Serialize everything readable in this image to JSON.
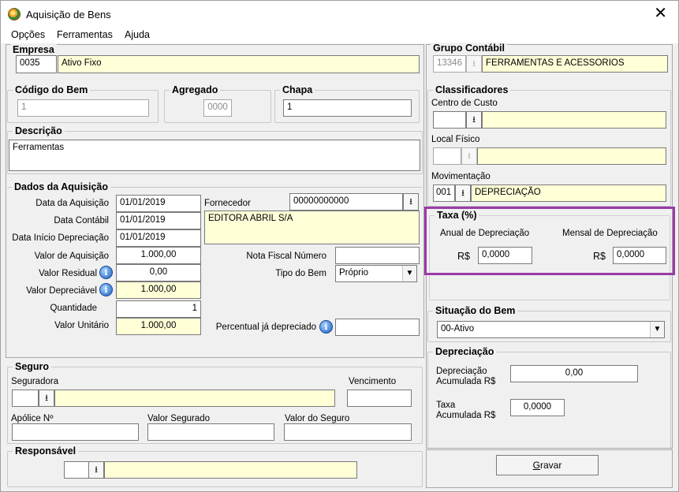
{
  "window": {
    "title": "Aquisição de Bens",
    "close_glyph": "✕"
  },
  "menu": [
    "Opções",
    "Ferramentas",
    "Ajuda"
  ],
  "empresa": {
    "legend": "Empresa",
    "code": "0035",
    "name": "Ativo Fixo"
  },
  "grupo": {
    "legend": "Grupo Contábil",
    "code": "13346",
    "name": "FERRAMENTAS E ACESSORIOS"
  },
  "codigo": {
    "legend": "Código do Bem",
    "value": "1"
  },
  "agregado": {
    "legend": "Agregado",
    "value": "0000"
  },
  "chapa": {
    "legend": "Chapa",
    "value": "1"
  },
  "descricao": {
    "legend": "Descrição",
    "value": "Ferramentas"
  },
  "classificadores": {
    "legend": "Classificadores",
    "centro_custo_label": "Centro de Custo",
    "local_fisico_label": "Local Físico",
    "movimentacao_label": "Movimentação",
    "movimentacao_code": "001",
    "movimentacao_name": "DEPRECIAÇÃO"
  },
  "dados": {
    "legend": "Dados da Aquisição",
    "data_aquisicao_label": "Data da Aquisição",
    "data_aquisicao": "01/01/2019",
    "data_contabil_label": "Data Contábil",
    "data_contabil": "01/01/2019",
    "data_inicio_label": "Data Início Depreciação",
    "data_inicio": "01/01/2019",
    "valor_aquisicao_label": "Valor de Aquisição",
    "valor_aquisicao": "1.000,00",
    "valor_residual_label": "Valor Residual",
    "valor_residual": "0,00",
    "valor_depreciavel_label": "Valor Depreciável",
    "valor_depreciavel": "1.000,00",
    "quantidade_label": "Quantidade",
    "quantidade": "1",
    "valor_unitario_label": "Valor Unitário",
    "valor_unitario": "1.000,00",
    "fornecedor_label": "Fornecedor",
    "fornecedor_code": "00000000000",
    "fornecedor_name": "EDITORA ABRIL S/A",
    "nota_fiscal_label": "Nota Fiscal Número",
    "nota_fiscal": "",
    "tipo_bem_label": "Tipo do Bem",
    "tipo_bem": "Próprio",
    "percentual_label": "Percentual já depreciado",
    "percentual": ""
  },
  "taxa": {
    "legend": "Taxa (%)",
    "anual_label": "Anual de Depreciação",
    "mensal_label": "Mensal de Depreciação",
    "currency": "R$",
    "anual": "0,0000",
    "mensal": "0,0000",
    "highlight_color": "#9b3aa8"
  },
  "situacao": {
    "legend": "Situação do Bem",
    "value": "00-Ativo"
  },
  "depreciacao": {
    "legend": "Depreciação",
    "acumulada_label_1": "Depreciação",
    "acumulada_label_2": "Acumulada R$",
    "acumulada": "0,00",
    "taxa_label_1": "Taxa",
    "taxa_label_2": "Acumulada R$",
    "taxa": "0,0000"
  },
  "seguro": {
    "legend": "Seguro",
    "seguradora_label": "Seguradora",
    "vencimento_label": "Vencimento",
    "apolice_label": "Apólice Nº",
    "valor_segurado_label": "Valor Segurado",
    "valor_seguro_label": "Valor do Seguro"
  },
  "responsavel": {
    "legend": "Responsável"
  },
  "gravar": {
    "label_underlined": "G",
    "label_rest": "ravar"
  },
  "icons": {
    "dropdown": "⭳",
    "select_arrow": "▼",
    "info": "i"
  }
}
